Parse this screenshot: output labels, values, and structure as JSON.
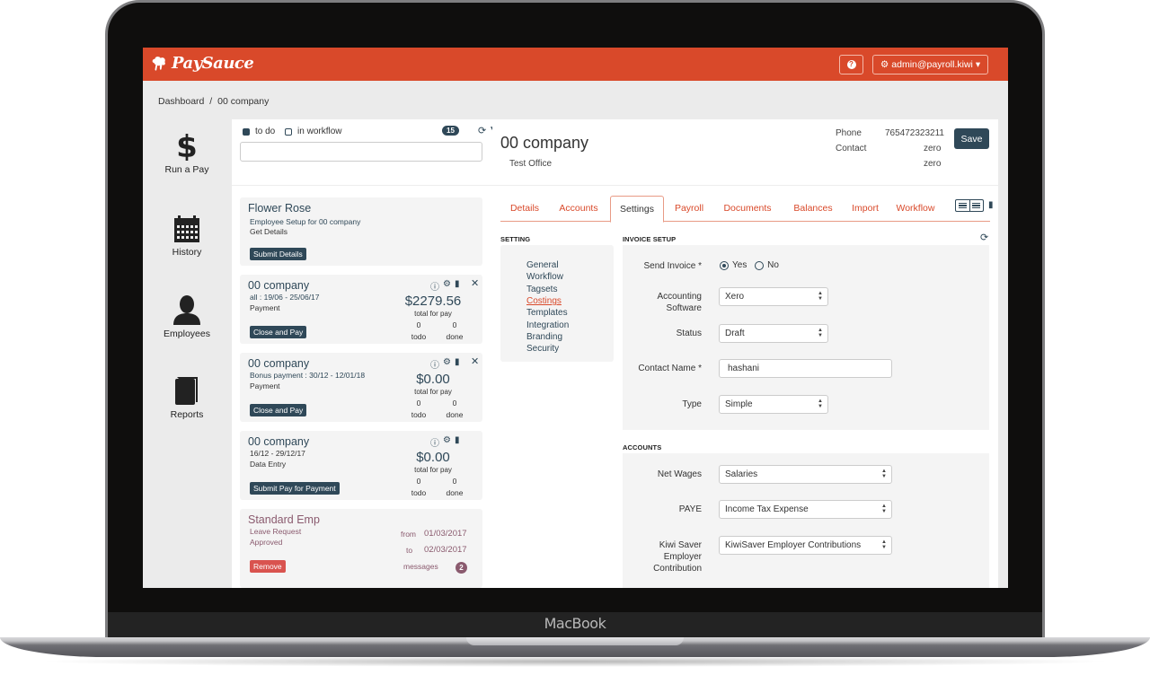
{
  "device": {
    "label": "MacBook"
  },
  "app": {
    "brand": "PaySauce",
    "brand_color": "#d9492a",
    "help_icon": "question-circle-icon",
    "user_menu": {
      "icon": "gear-icon",
      "label": "admin@payroll.kiwi",
      "caret": "▾"
    }
  },
  "breadcrumb": [
    "Dashboard",
    "/",
    "00 company"
  ],
  "nav": [
    {
      "label": "Run a Pay",
      "icon": "dollar-icon"
    },
    {
      "label": "History",
      "icon": "calendar-icon"
    },
    {
      "label": "Employees",
      "icon": "user-icon"
    },
    {
      "label": "Reports",
      "icon": "book-icon"
    }
  ],
  "tasks": {
    "filters": [
      {
        "label": "to do",
        "checked": true
      },
      {
        "label": "in workflow",
        "checked": false
      }
    ],
    "count": "15",
    "search_value": "",
    "cards": [
      {
        "title": "Flower Rose",
        "line1": "Employee Setup for 00 company",
        "line2": "Get Details",
        "button": "Submit Details"
      },
      {
        "title": "00 company",
        "line1": "all : 19/06 - 25/06/17",
        "line2": "Payment",
        "button": "Close and Pay",
        "amount": "$2279.56",
        "amount_label": "total for pay",
        "todo_count": "0",
        "todo_label": "todo",
        "done_count": "0",
        "done_label": "done",
        "closable": true
      },
      {
        "title": "00 company",
        "line1": "Bonus payment : 30/12 - 12/01/18",
        "line2": "Payment",
        "button": "Close and Pay",
        "amount": "$0.00",
        "amount_label": "total for pay",
        "todo_count": "0",
        "todo_label": "todo",
        "done_count": "0",
        "done_label": "done",
        "closable": true
      },
      {
        "title": "00 company",
        "line1": "16/12 - 29/12/17",
        "line2": "Data Entry",
        "button": "Submit Pay for Payment",
        "amount": "$0.00",
        "amount_label": "total for pay",
        "todo_count": "0",
        "todo_label": "todo",
        "done_count": "0",
        "done_label": "done",
        "closable": false
      },
      {
        "title": "Standard Emp",
        "line1": "Leave Request",
        "line2": "Approved",
        "button": "Remove",
        "from_label": "from",
        "from_value": "01/03/2017",
        "to_label": "to",
        "to_value": "02/03/2017",
        "messages_label": "messages",
        "messages_count": "2"
      }
    ]
  },
  "company": {
    "name": "00 company",
    "office": "Test Office",
    "phone_label": "Phone",
    "phone": "765472323211",
    "contact_label": "Contact",
    "contact_line1": "zero",
    "contact_line2": "zero",
    "save_label": "Save"
  },
  "tabs": [
    {
      "label": "Details",
      "active": false
    },
    {
      "label": "Accounts",
      "active": false
    },
    {
      "label": "Settings",
      "active": true
    },
    {
      "label": "Payroll",
      "active": false
    },
    {
      "label": "Documents",
      "active": false
    },
    {
      "label": "Balances",
      "active": false
    },
    {
      "label": "Import",
      "active": false
    },
    {
      "label": "Workflow",
      "active": false
    }
  ],
  "settings": {
    "heading": "SETTING",
    "links": [
      {
        "label": "General",
        "active": false
      },
      {
        "label": "Workflow",
        "active": false
      },
      {
        "label": "Tagsets",
        "active": false
      },
      {
        "label": "Costings",
        "active": true
      },
      {
        "label": "Templates",
        "active": false
      },
      {
        "label": "Integration",
        "active": false
      },
      {
        "label": "Branding",
        "active": false
      },
      {
        "label": "Security",
        "active": false
      }
    ]
  },
  "invoice_setup": {
    "heading": "INVOICE SETUP",
    "send_invoice": {
      "label": "Send Invoice *",
      "options": [
        "Yes",
        "No"
      ],
      "selected": "Yes"
    },
    "accounting_software": {
      "label_line1": "Accounting",
      "label_line2": "Software",
      "value": "Xero"
    },
    "status": {
      "label": "Status",
      "value": "Draft"
    },
    "contact_name": {
      "label": "Contact Name *",
      "value": "hashani"
    },
    "type": {
      "label": "Type",
      "value": "Simple"
    }
  },
  "accounts": {
    "heading": "ACCOUNTS",
    "net_wages": {
      "label": "Net Wages",
      "value": "Salaries"
    },
    "paye": {
      "label": "PAYE",
      "value": "Income Tax Expense"
    },
    "kiwisaver": {
      "label_line1": "Kiwi Saver",
      "label_line2": "Employer",
      "label_line3": "Contribution",
      "value": "KiwiSaver Employer Contributions"
    }
  }
}
